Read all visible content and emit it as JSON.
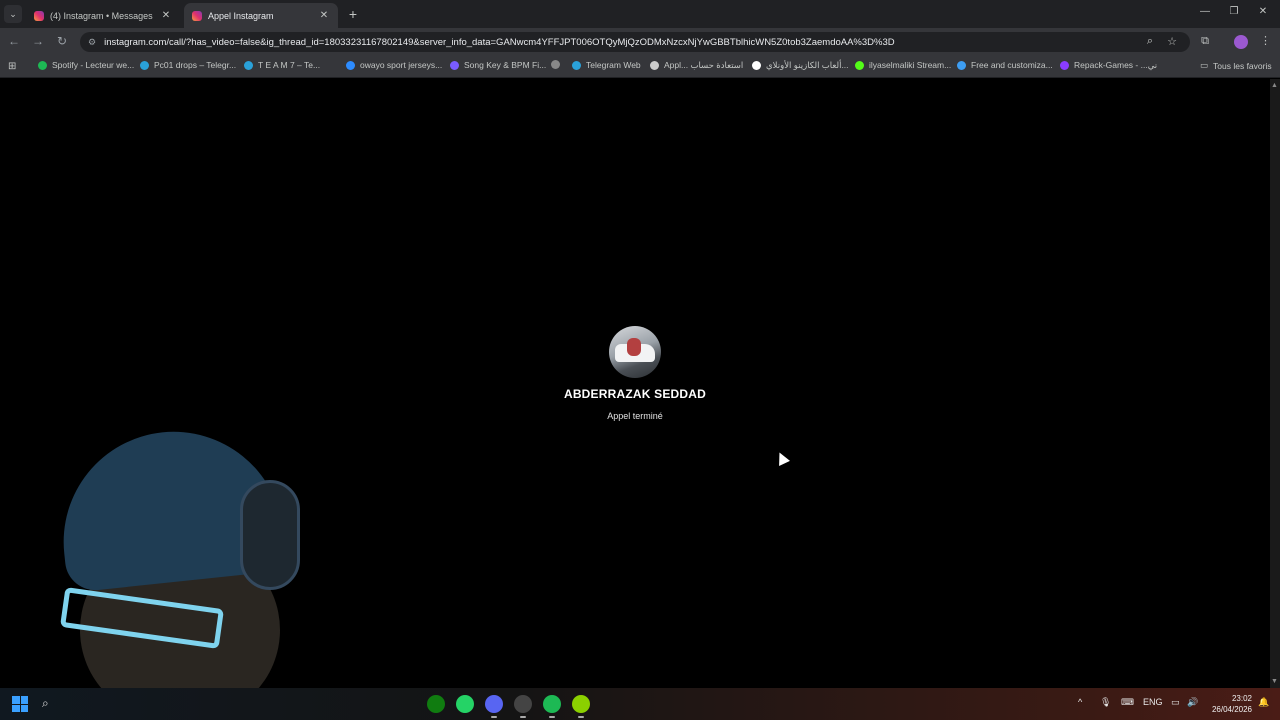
{
  "tabs": [
    {
      "title": "(4) Instagram • Messages",
      "active": false
    },
    {
      "title": "Appel Instagram",
      "active": true
    }
  ],
  "address": {
    "url": "instagram.com/call/?has_video=false&ig_thread_id=18033231167802149&server_info_data=GANwcm4YFFJPT006OTQyMjQzODMxNzcxNjYwGBBTblhicWN5Z0tob3ZaemdoAA%3D%3D"
  },
  "bookmarks": [
    {
      "label": "Spotify - Lecteur we...",
      "color": "#1db954"
    },
    {
      "label": "Pc01 drops – Telegr...",
      "color": "#2aa1d9"
    },
    {
      "label": "T E A M 7 – Te...",
      "color": "#2aa1d9"
    },
    {
      "label": "owayo sport jerseys...",
      "color": "#2d8cff"
    },
    {
      "label": "Song Key & BPM Fi...",
      "color": "#7a5cff"
    },
    {
      "label": "",
      "color": "#888888"
    },
    {
      "label": "Telegram Web",
      "color": "#2aa1d9"
    },
    {
      "label": "Appl... استعادة حساب",
      "color": "#cccccc"
    },
    {
      "label": "ألعاب الكازينو الأونلاي...",
      "color": "#ffffff"
    },
    {
      "label": "ilyaselmaliki Stream...",
      "color": "#53fc18"
    },
    {
      "label": "Free and customiza...",
      "color": "#3d9df2"
    },
    {
      "label": "Repack-Games - ...ني",
      "color": "#8a3cff"
    }
  ],
  "bookmarks_all": "Tous les favoris",
  "call": {
    "name": "ABDERRAZAK SEDDAD",
    "status": "Appel terminé"
  },
  "taskbar": {
    "language": "ENG",
    "time": "23:02",
    "date": "26/04/2026",
    "apps": [
      {
        "icon": "xbox-icon",
        "color": "#107c10"
      },
      {
        "icon": "whatsapp-icon",
        "color": "#25d366"
      },
      {
        "icon": "discord-icon",
        "color": "#5865f2"
      },
      {
        "icon": "app-icon",
        "color": "#444444"
      },
      {
        "icon": "spotify-icon",
        "color": "#1db954"
      },
      {
        "icon": "media-app-icon",
        "color": "#8bd000"
      }
    ]
  }
}
